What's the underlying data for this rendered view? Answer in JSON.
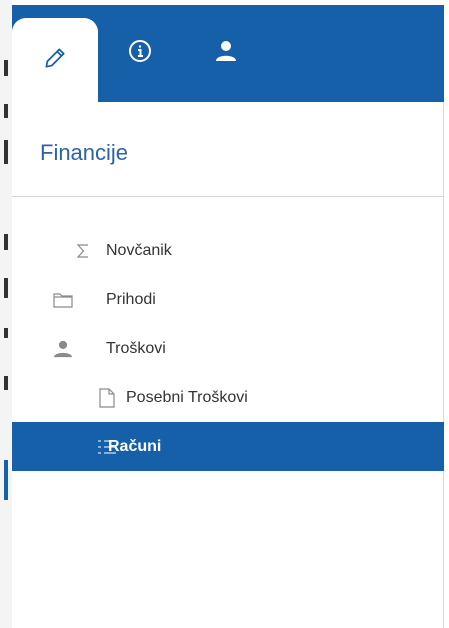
{
  "tabs": [
    {
      "name": "edit",
      "icon": "pencil-icon",
      "active": true
    },
    {
      "name": "info",
      "icon": "info-icon",
      "active": false
    },
    {
      "name": "user",
      "icon": "user-icon",
      "active": false
    }
  ],
  "header": {
    "title": "Financije"
  },
  "tree": {
    "items": [
      {
        "label": "Novčanik",
        "icon": "sigma-icon",
        "level": 0,
        "selected": false
      },
      {
        "label": "Prihodi",
        "icon": "folder-icon",
        "level": 0,
        "selected": false
      },
      {
        "label": "Troškovi",
        "icon": "user-icon",
        "level": 0,
        "selected": false
      },
      {
        "label": "Posebni Troškovi",
        "icon": "document-icon",
        "level": 1,
        "selected": false
      },
      {
        "label": "Računi",
        "icon": "list-icon",
        "level": 1,
        "selected": true
      }
    ]
  },
  "colors": {
    "accent": "#1560a8",
    "title": "#2c63a8",
    "text": "#333333"
  }
}
